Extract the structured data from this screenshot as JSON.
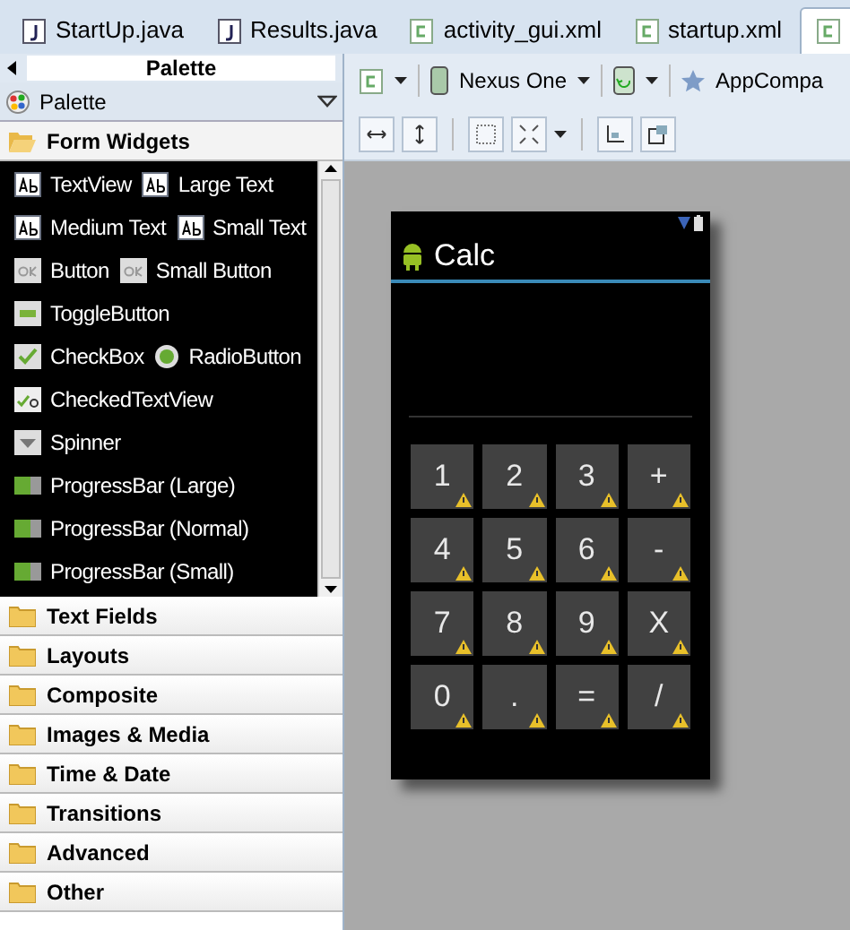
{
  "tabs": [
    {
      "label": "StartUp.java",
      "kind": "java",
      "selected": false
    },
    {
      "label": "Results.java",
      "kind": "java",
      "selected": false
    },
    {
      "label": "activity_gui.xml",
      "kind": "xml",
      "selected": false
    },
    {
      "label": "startup.xml",
      "kind": "xml",
      "selected": false
    },
    {
      "kind": "xml",
      "selected": true
    }
  ],
  "palette": {
    "title": "Palette",
    "dropdown": "Palette",
    "open_category": "Form Widgets",
    "widget_rows": [
      [
        {
          "label": "TextView",
          "kind": "ab"
        },
        {
          "label": "Large Text",
          "kind": "ab"
        }
      ],
      [
        {
          "label": "Medium Text",
          "kind": "ab"
        },
        {
          "label": "Small Text",
          "kind": "ab"
        }
      ],
      [
        {
          "label": "Button",
          "kind": "ok"
        },
        {
          "label": "Small Button",
          "kind": "ok"
        }
      ],
      [
        {
          "label": "ToggleButton",
          "kind": "toggle"
        }
      ],
      [
        {
          "label": "CheckBox",
          "kind": "check"
        },
        {
          "label": "RadioButton",
          "kind": "radio"
        }
      ],
      [
        {
          "label": "CheckedTextView",
          "kind": "checkedtext"
        }
      ],
      [
        {
          "label": "Spinner",
          "kind": "spinner"
        }
      ],
      [
        {
          "label": "ProgressBar (Large)",
          "kind": "progress"
        }
      ],
      [
        {
          "label": "ProgressBar (Normal)",
          "kind": "progress"
        }
      ],
      [
        {
          "label": "ProgressBar (Small)",
          "kind": "progress"
        }
      ]
    ],
    "categories": [
      "Text Fields",
      "Layouts",
      "Composite",
      "Images & Media",
      "Time & Date",
      "Transitions",
      "Advanced",
      "Other"
    ]
  },
  "toolbar": {
    "device": "Nexus One",
    "theme": "AppCompa"
  },
  "phone": {
    "app_title": "Calc",
    "keys": [
      [
        "1",
        "2",
        "3",
        "+"
      ],
      [
        "4",
        "5",
        "6",
        "-"
      ],
      [
        "7",
        "8",
        "9",
        "X"
      ],
      [
        "0",
        ".",
        "=",
        "/"
      ]
    ]
  }
}
